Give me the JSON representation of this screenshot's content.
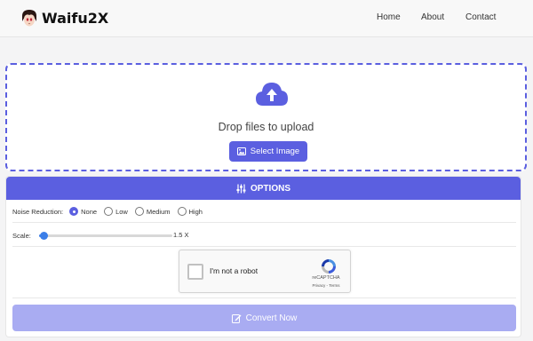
{
  "header": {
    "brand": "Waifu2X",
    "nav": [
      {
        "label": "Home"
      },
      {
        "label": "About"
      },
      {
        "label": "Contact"
      }
    ]
  },
  "upload": {
    "icon": "cloud-upload-icon",
    "drop_text": "Drop files to upload",
    "select_label": "Select Image"
  },
  "options": {
    "header_label": "OPTIONS",
    "noise_label": "Noise Reduction:",
    "noise_options": [
      {
        "label": "None",
        "selected": true
      },
      {
        "label": "Low",
        "selected": false
      },
      {
        "label": "Medium",
        "selected": false
      },
      {
        "label": "High",
        "selected": false
      }
    ],
    "scale_label": "Scale:",
    "scale_value_text": "1.5 X",
    "scale_min": 1,
    "scale_max": 4,
    "scale_value": 1.1
  },
  "captcha": {
    "label": "I'm not a robot",
    "brand": "reCAPTCHA",
    "links": "Privacy - Terms"
  },
  "convert": {
    "label": "Convert Now"
  },
  "colors": {
    "accent": "#5b5fe0",
    "convert_disabled": "#a9acf2",
    "slider": "#3b7ee8"
  }
}
